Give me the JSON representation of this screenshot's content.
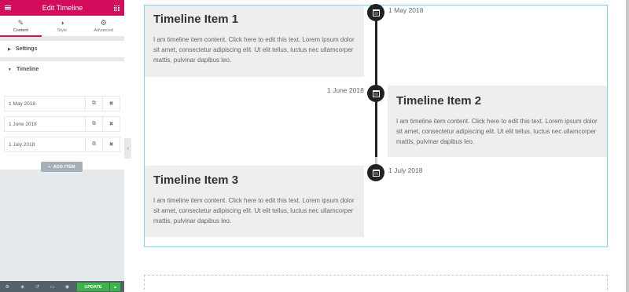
{
  "panel": {
    "header_title": "Edit Timeline",
    "tabs": [
      {
        "label": "Content",
        "icon": "pencil-icon"
      },
      {
        "label": "Style",
        "icon": "contrast-icon"
      },
      {
        "label": "Advanced",
        "icon": "gear-icon"
      }
    ],
    "sections": {
      "settings": "Settings",
      "timeline": "Timeline"
    },
    "repeater_items": [
      {
        "label": "1 May 2018"
      },
      {
        "label": "1 June 2018"
      },
      {
        "label": "1 July 2018"
      }
    ],
    "add_item_label": "ADD ITEM",
    "update_label": "UPDATE"
  },
  "timeline": {
    "items": [
      {
        "date": "1 May 2018",
        "title": "Timeline Item 1",
        "text": "I am timeline item content. Click here to edit this text. Lorem ipsum dolor sit amet, consectetur adipiscing elit. Ut elit tellus, luctus nec ullamcorper mattis, pulvinar dapibus leo."
      },
      {
        "date": "1 June 2018",
        "title": "Timeline Item 2",
        "text": "I am timeline item content. Click here to edit this text. Lorem ipsum dolor sit amet, consectetur adipiscing elit. Ut elit tellus, luctus nec ullamcorper mattis, pulvinar dapibus leo."
      },
      {
        "date": "1 July 2018",
        "title": "Timeline Item 3",
        "text": "I am timeline item content. Click here to edit this text. Lorem ipsum dolor sit amet, consectetur adipiscing elit. Ut elit tellus, luctus nec ullamcorper mattis, pulvinar dapibus leo."
      }
    ]
  },
  "colors": {
    "brand": "#d30c5c",
    "update": "#39b54a",
    "timeline_line": "#222222",
    "card_bg": "#eeeeee",
    "selection_border": "#71d7f7"
  }
}
